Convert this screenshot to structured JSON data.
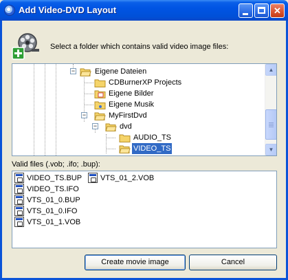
{
  "window": {
    "title": "Add Video-DVD Layout",
    "controls": {
      "minimize": "",
      "maximize": "",
      "close": "✕"
    }
  },
  "header": {
    "icon": "film-reel-add-icon",
    "instruction": "Select a folder which contains valid video image files:"
  },
  "tree": {
    "items": [
      {
        "label": "Eigene Dateien",
        "expander": "−",
        "icon": "folder-open-icon"
      },
      {
        "label": "CDBurnerXP Projects",
        "expander": "",
        "icon": "folder-icon"
      },
      {
        "label": "Eigene Bilder",
        "expander": "",
        "icon": "folder-pictures-icon"
      },
      {
        "label": "Eigene Musik",
        "expander": "",
        "icon": "folder-music-icon"
      },
      {
        "label": "MyFirstDvd",
        "expander": "−",
        "icon": "folder-open-icon"
      },
      {
        "label": "dvd",
        "expander": "−",
        "icon": "folder-open-icon"
      },
      {
        "label": "AUDIO_TS",
        "expander": "",
        "icon": "folder-icon"
      },
      {
        "label": "VIDEO_TS",
        "expander": "",
        "icon": "folder-open-icon",
        "selected": true
      }
    ],
    "scrollbar": {
      "up": "▲",
      "down": "▼"
    }
  },
  "files": {
    "label": "Valid files (.vob; .ifo; .bup):",
    "items": [
      "VIDEO_TS.BUP",
      "VIDEO_TS.IFO",
      "VTS_01_0.BUP",
      "VTS_01_0.IFO",
      "VTS_01_1.VOB",
      "VTS_01_2.VOB"
    ]
  },
  "buttons": {
    "create": "Create movie image",
    "cancel": "Cancel"
  },
  "colors": {
    "titlebar": "#0054e3",
    "selection": "#316ac5",
    "folder": "#f5d46a",
    "window_bg": "#ece9d8"
  }
}
